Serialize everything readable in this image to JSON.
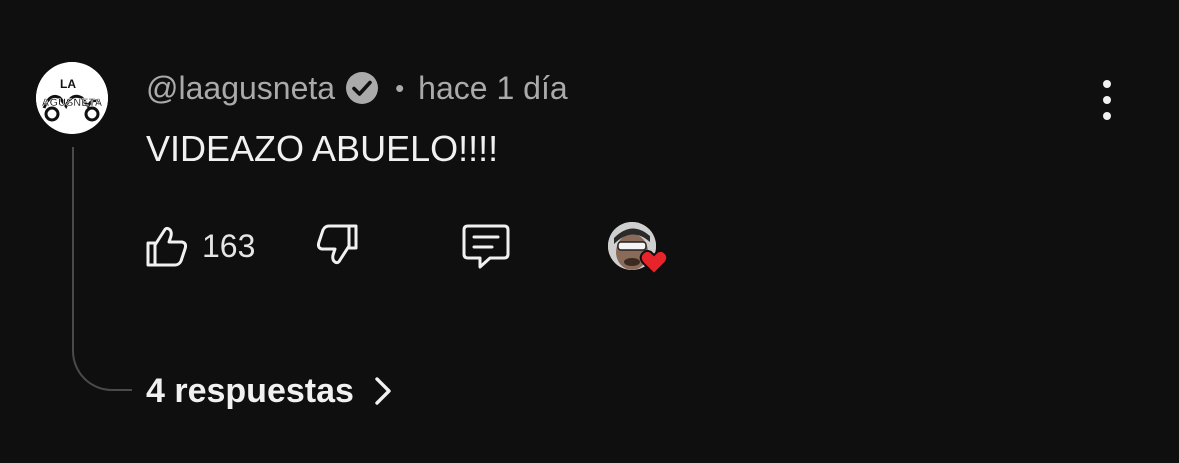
{
  "comment": {
    "author": {
      "handle": "@laagusneta",
      "verified": true,
      "avatar_icon": "la-agusneta-logo-icon",
      "avatar_logo_text": "LA AGUSNETA"
    },
    "separator": "•",
    "timestamp": "hace 1 día",
    "text": "VIDEAZO ABUELO!!!!",
    "likes": "163",
    "icons": {
      "like": "thumbs-up-icon",
      "dislike": "thumbs-down-icon",
      "reply": "comment-reply-icon",
      "more": "more-vertical-icon",
      "creator_heart": "heart-icon"
    },
    "creator_heart": true,
    "replies": {
      "label": "4 respuestas"
    }
  },
  "colors": {
    "background": "#0f0f0f",
    "primary_text": "#f1f1f1",
    "secondary_text": "#aaaaaa",
    "heart": "#e62429",
    "thread_line": "#4a4a4a"
  }
}
